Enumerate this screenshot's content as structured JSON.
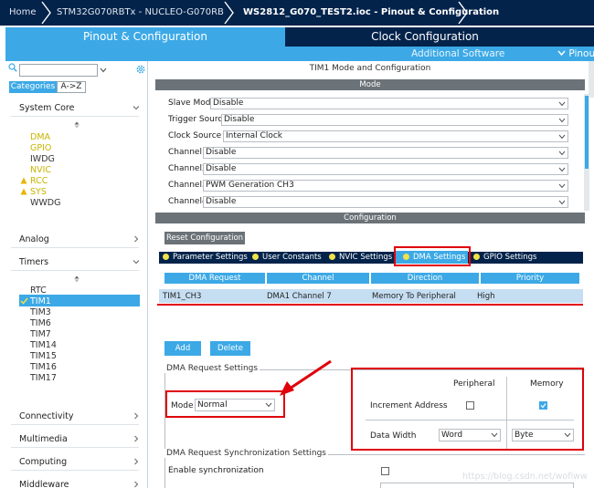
{
  "breadcrumb": {
    "home": "Home",
    "device": "STM32G070RBTx  -  NUCLEO-G070RB",
    "file": "WS2812_G070_TEST2.ioc - Pinout & Configuration"
  },
  "main_tabs": {
    "pinout": "Pinout & Configuration",
    "clock": "Clock Configuration",
    "additional": "Additional Software",
    "pinout_menu": "Pinou"
  },
  "left": {
    "search_placeholder": "",
    "btn_categories": "Categories",
    "btn_az": "A->Z",
    "categories": {
      "system_core": "System Core",
      "analog": "Analog",
      "timers": "Timers",
      "connectivity": "Connectivity",
      "multimedia": "Multimedia",
      "computing": "Computing",
      "middleware": "Middleware"
    },
    "system_items": [
      "DMA",
      "GPIO",
      "IWDG",
      "NVIC",
      "RCC",
      "SYS",
      "WWDG"
    ],
    "timer_items": [
      "RTC",
      "TIM1",
      "TIM3",
      "TIM6",
      "TIM7",
      "TIM14",
      "TIM15",
      "TIM16",
      "TIM17"
    ]
  },
  "right": {
    "title": "TIM1 Mode and Configuration",
    "mode_header": "Mode",
    "mode_rows": [
      {
        "label": "Slave Mode",
        "value": "Disable"
      },
      {
        "label": "Trigger Source",
        "value": "Disable"
      },
      {
        "label": "Clock Source",
        "value": "Internal Clock"
      },
      {
        "label": "Channel1",
        "value": "Disable"
      },
      {
        "label": "Channel2",
        "value": "Disable"
      },
      {
        "label": "Channel3",
        "value": "PWM Generation CH3"
      },
      {
        "label": "Channel4",
        "value": "Disable"
      }
    ],
    "config_header": "Configuration",
    "reset_btn": "Reset Configuration",
    "cfg_tabs": {
      "parameter": "Parameter Settings",
      "user_constants": "User Constants",
      "nvic": "NVIC Settings",
      "dma": "DMA Settings",
      "gpio": "GPIO Settings"
    },
    "dma_table": {
      "headers": [
        "DMA Request",
        "Channel",
        "Direction",
        "Priority"
      ],
      "rows": [
        [
          "TIM1_CH3",
          "DMA1 Channel 7",
          "Memory To Peripheral",
          "High"
        ]
      ]
    },
    "add_btn": "Add",
    "delete_btn": "Delete",
    "dma_request_settings": "DMA Request Settings",
    "mode_label": "Mode",
    "mode_value": "Normal",
    "peripheral": "Peripheral",
    "memory": "Memory",
    "increment_address": "Increment Address",
    "data_width": "Data Width",
    "periph_width": "Word",
    "mem_width": "Byte",
    "sync_settings": "DMA Request Synchronization Settings",
    "enable_sync": "Enable synchronization"
  },
  "watermark": "https://blog.csdn.net/wofiww",
  "colors": {
    "navy": "#03234b",
    "blue": "#3ca9e6",
    "gray_header": "#6b7278",
    "highlight_red": "#e0000a",
    "yellow": "#c8b400"
  }
}
